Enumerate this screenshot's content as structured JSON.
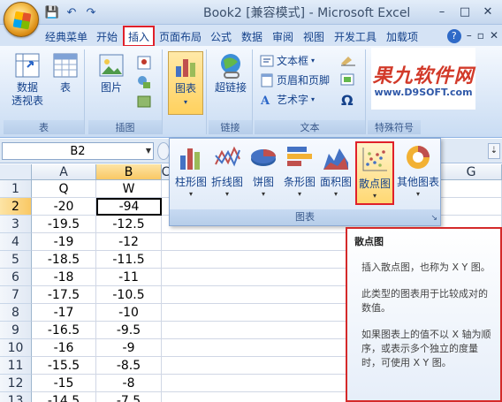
{
  "window": {
    "title": "Book2  [兼容模式] - Microsoft Excel",
    "min": "–",
    "max": "□",
    "close": "✕"
  },
  "qat": {
    "save": "💾",
    "undo": "↶",
    "redo": "↷"
  },
  "tabs": [
    {
      "label": "经典菜单"
    },
    {
      "label": "开始"
    },
    {
      "label": "插入"
    },
    {
      "label": "页面布局"
    },
    {
      "label": "公式"
    },
    {
      "label": "数据"
    },
    {
      "label": "审阅"
    },
    {
      "label": "视图"
    },
    {
      "label": "开发工具"
    },
    {
      "label": "加载项"
    }
  ],
  "tab_right": {
    "help": "?",
    "min": "–",
    "restore": "▫",
    "close": "✕"
  },
  "ribbon": {
    "tables": {
      "pivot": "数据\n透视表",
      "table": "表",
      "label": "表"
    },
    "illustrations": {
      "picture": "图片",
      "label": "插图"
    },
    "charts": {
      "chart": "图表",
      "label": ""
    },
    "links": {
      "hyperlink": "超链接",
      "label": "链接"
    },
    "text": {
      "textbox": "文本框",
      "header_footer": "页眉和页脚",
      "wordart": "艺术字",
      "label": "文本"
    },
    "special": {
      "label": "特殊符号",
      "comma": ","
    }
  },
  "watermark": {
    "top": "果九软件网",
    "bottom": "www.D9SOFT.com"
  },
  "formula_bar": {
    "name_box": "B2"
  },
  "grid": {
    "col_headers": [
      "A",
      "B"
    ],
    "extra_col": "C",
    "col_g": "G",
    "rows": [
      {
        "n": "1",
        "a": "Q",
        "b": "W"
      },
      {
        "n": "2",
        "a": "-20",
        "b": "-94"
      },
      {
        "n": "3",
        "a": "-19.5",
        "b": "-12.5"
      },
      {
        "n": "4",
        "a": "-19",
        "b": "-12"
      },
      {
        "n": "5",
        "a": "-18.5",
        "b": "-11.5"
      },
      {
        "n": "6",
        "a": "-18",
        "b": "-11"
      },
      {
        "n": "7",
        "a": "-17.5",
        "b": "-10.5"
      },
      {
        "n": "8",
        "a": "-17",
        "b": "-10"
      },
      {
        "n": "9",
        "a": "-16.5",
        "b": "-9.5"
      },
      {
        "n": "10",
        "a": "-16",
        "b": "-9"
      },
      {
        "n": "11",
        "a": "-15.5",
        "b": "-8.5"
      },
      {
        "n": "12",
        "a": "-15",
        "b": "-8"
      },
      {
        "n": "13",
        "a": "-14.5",
        "b": "-7.5"
      }
    ]
  },
  "chart_panel": {
    "buttons": [
      {
        "label": "柱形图"
      },
      {
        "label": "折线图"
      },
      {
        "label": "饼图"
      },
      {
        "label": "条形图"
      },
      {
        "label": "面积图"
      },
      {
        "label": "散点图"
      },
      {
        "label": "其他图表"
      }
    ],
    "label": "图表"
  },
  "tooltip": {
    "title": "散点图",
    "p1": "插入散点图，也称为 X Y 图。",
    "p2": "此类型的图表用于比较成对的数值。",
    "p3": "如果图表上的值不以 X 轴为顺序，或表示多个独立的度量时，可使用 X Y 图。"
  },
  "colors": {
    "accent": "#15428b",
    "highlight": "#e0202a"
  }
}
